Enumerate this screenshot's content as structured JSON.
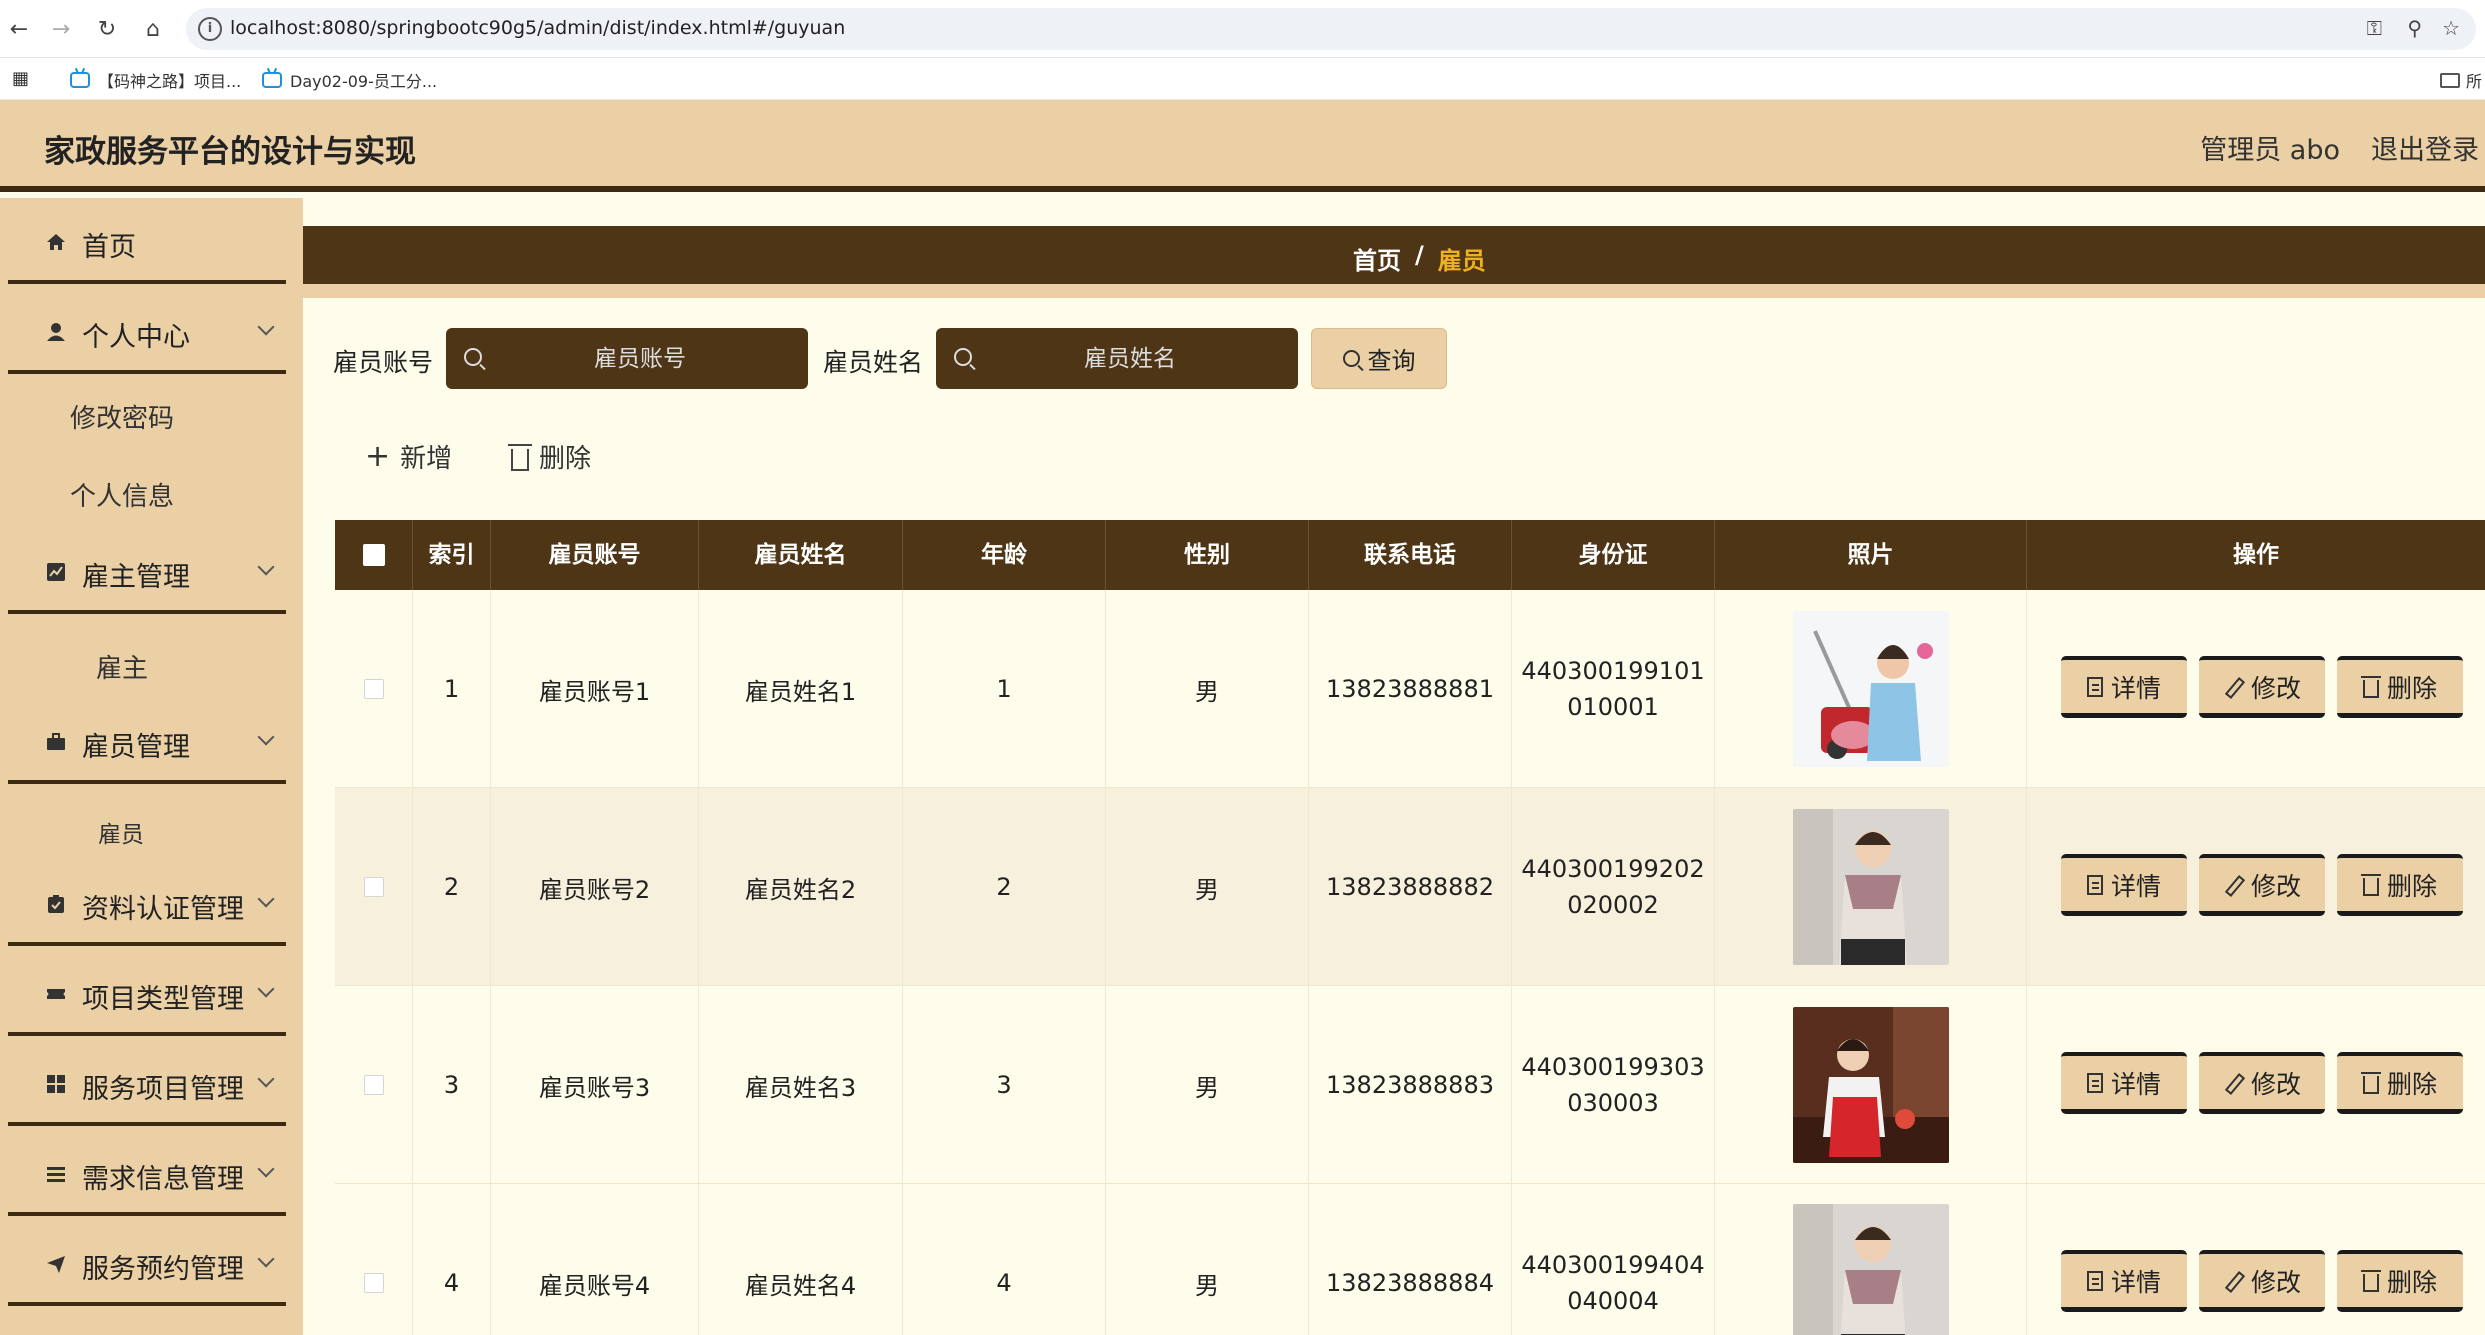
{
  "browser": {
    "url": "localhost:8080/springbootc90g5/admin/dist/index.html#/guyuan",
    "bookmarks": [
      "【码神之路】项目...",
      "Day02-09-员工分..."
    ],
    "bookmark_folder": "所"
  },
  "header": {
    "title": "家政服务平台的设计与实现",
    "admin_label": "管理员 abo",
    "logout_label": "退出登录"
  },
  "sidebar": {
    "home": "首页",
    "personal_center": "个人中心",
    "change_password": "修改密码",
    "personal_info": "个人信息",
    "employer_mgmt": "雇主管理",
    "employer": "雇主",
    "employee_mgmt": "雇员管理",
    "employee": "雇员",
    "cert_mgmt": "资料认证管理",
    "project_type_mgmt": "项目类型管理",
    "service_project_mgmt": "服务项目管理",
    "demand_info_mgmt": "需求信息管理",
    "service_booking_mgmt": "服务预约管理"
  },
  "breadcrumb": {
    "home": "首页",
    "separator": "/",
    "current": "雇员"
  },
  "search": {
    "account_label": "雇员账号",
    "account_placeholder": "雇员账号",
    "name_label": "雇员姓名",
    "name_placeholder": "雇员姓名",
    "query_label": "查询"
  },
  "actions": {
    "add_label": "新增",
    "delete_label": "删除"
  },
  "table": {
    "headers": {
      "index": "索引",
      "account": "雇员账号",
      "name": "雇员姓名",
      "age": "年龄",
      "gender": "性别",
      "phone": "联系电话",
      "idcard": "身份证",
      "photo": "照片",
      "operation": "操作"
    },
    "rows": [
      {
        "index": "1",
        "account": "雇员账号1",
        "name": "雇员姓名1",
        "age": "1",
        "gender": "男",
        "phone": "13823888881",
        "idcard": "440300199101010001"
      },
      {
        "index": "2",
        "account": "雇员账号2",
        "name": "雇员姓名2",
        "age": "2",
        "gender": "男",
        "phone": "13823888882",
        "idcard": "440300199202020002"
      },
      {
        "index": "3",
        "account": "雇员账号3",
        "name": "雇员姓名3",
        "age": "3",
        "gender": "男",
        "phone": "13823888883",
        "idcard": "440300199303030003"
      },
      {
        "index": "4",
        "account": "雇员账号4",
        "name": "雇员姓名4",
        "age": "4",
        "gender": "男",
        "phone": "13823888884",
        "idcard": "440300199404040004"
      }
    ],
    "row_buttons": {
      "detail": "详情",
      "edit": "修改",
      "delete": "删除"
    }
  },
  "colors": {
    "header_bg": "#ebd0a6",
    "dark_brown": "#4d3516",
    "content_bg": "#fefcea",
    "breadcrumb_current": "#f0b020"
  }
}
